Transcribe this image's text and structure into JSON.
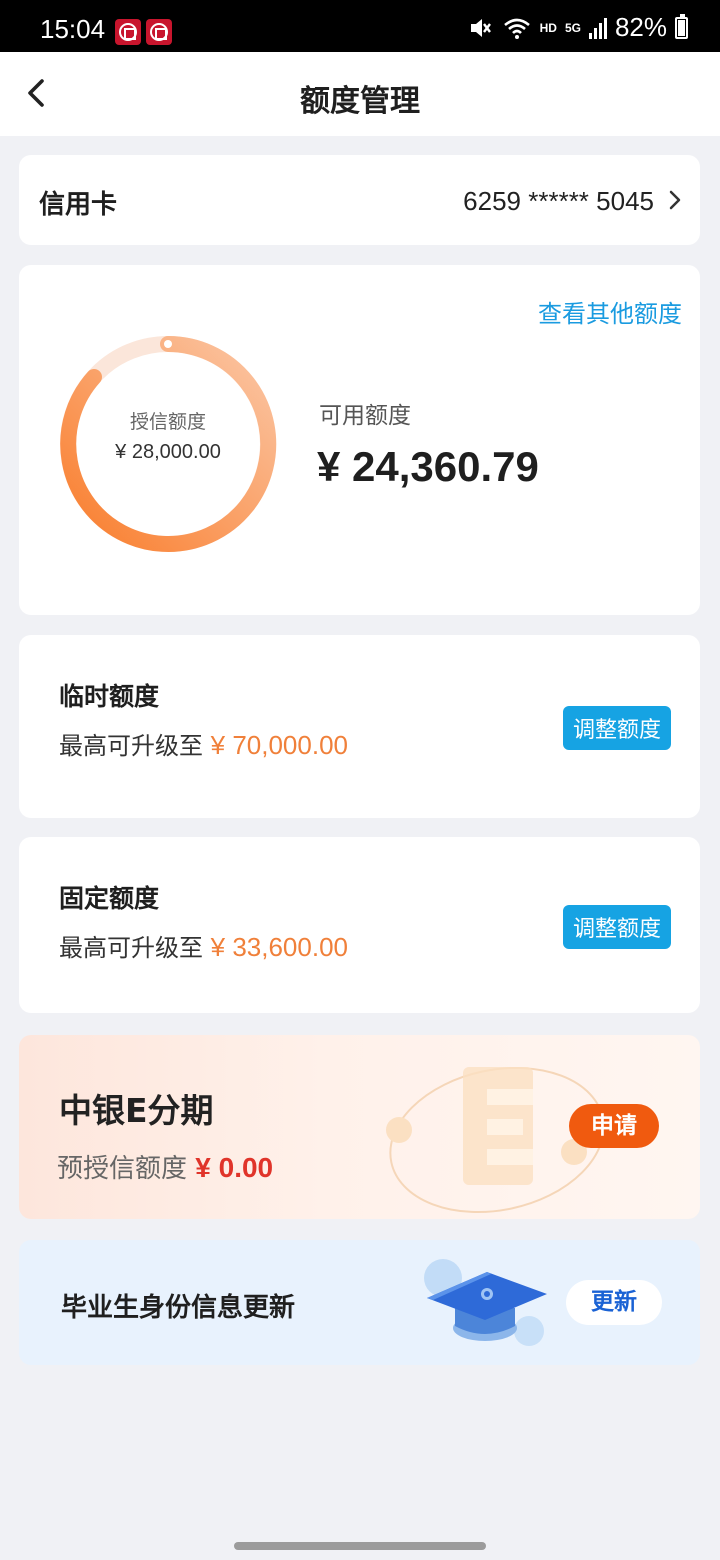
{
  "status_bar": {
    "time": "15:04",
    "network": "5G",
    "hd": "HD",
    "battery": "82%"
  },
  "header": {
    "title": "额度管理"
  },
  "card_row": {
    "type": "信用卡",
    "number": "6259 ****** 5045"
  },
  "limit": {
    "other_link": "查看其他额度",
    "credit_label": "授信额度",
    "credit_value": "¥ 28,000.00",
    "available_label": "可用额度",
    "available_value": "¥ 24,360.79"
  },
  "temporary": {
    "title": "临时额度",
    "prefix": "最高可升级至",
    "amount": "¥ 70,000.00",
    "button": "调整额度"
  },
  "fixed": {
    "title": "固定额度",
    "prefix": "最高可升级至",
    "amount": "¥ 33,600.00",
    "button": "调整额度"
  },
  "installment": {
    "title": "中银E分期",
    "prefix": "预授信额度",
    "amount": "¥ 0.00",
    "button": "申请"
  },
  "graduate": {
    "title": "毕业生身份信息更新",
    "button": "更新"
  },
  "colors": {
    "accent_blue": "#16a3e3",
    "accent_orange": "#f0803a",
    "apply_orange": "#f05a0f",
    "amount_red": "#e0342a"
  }
}
